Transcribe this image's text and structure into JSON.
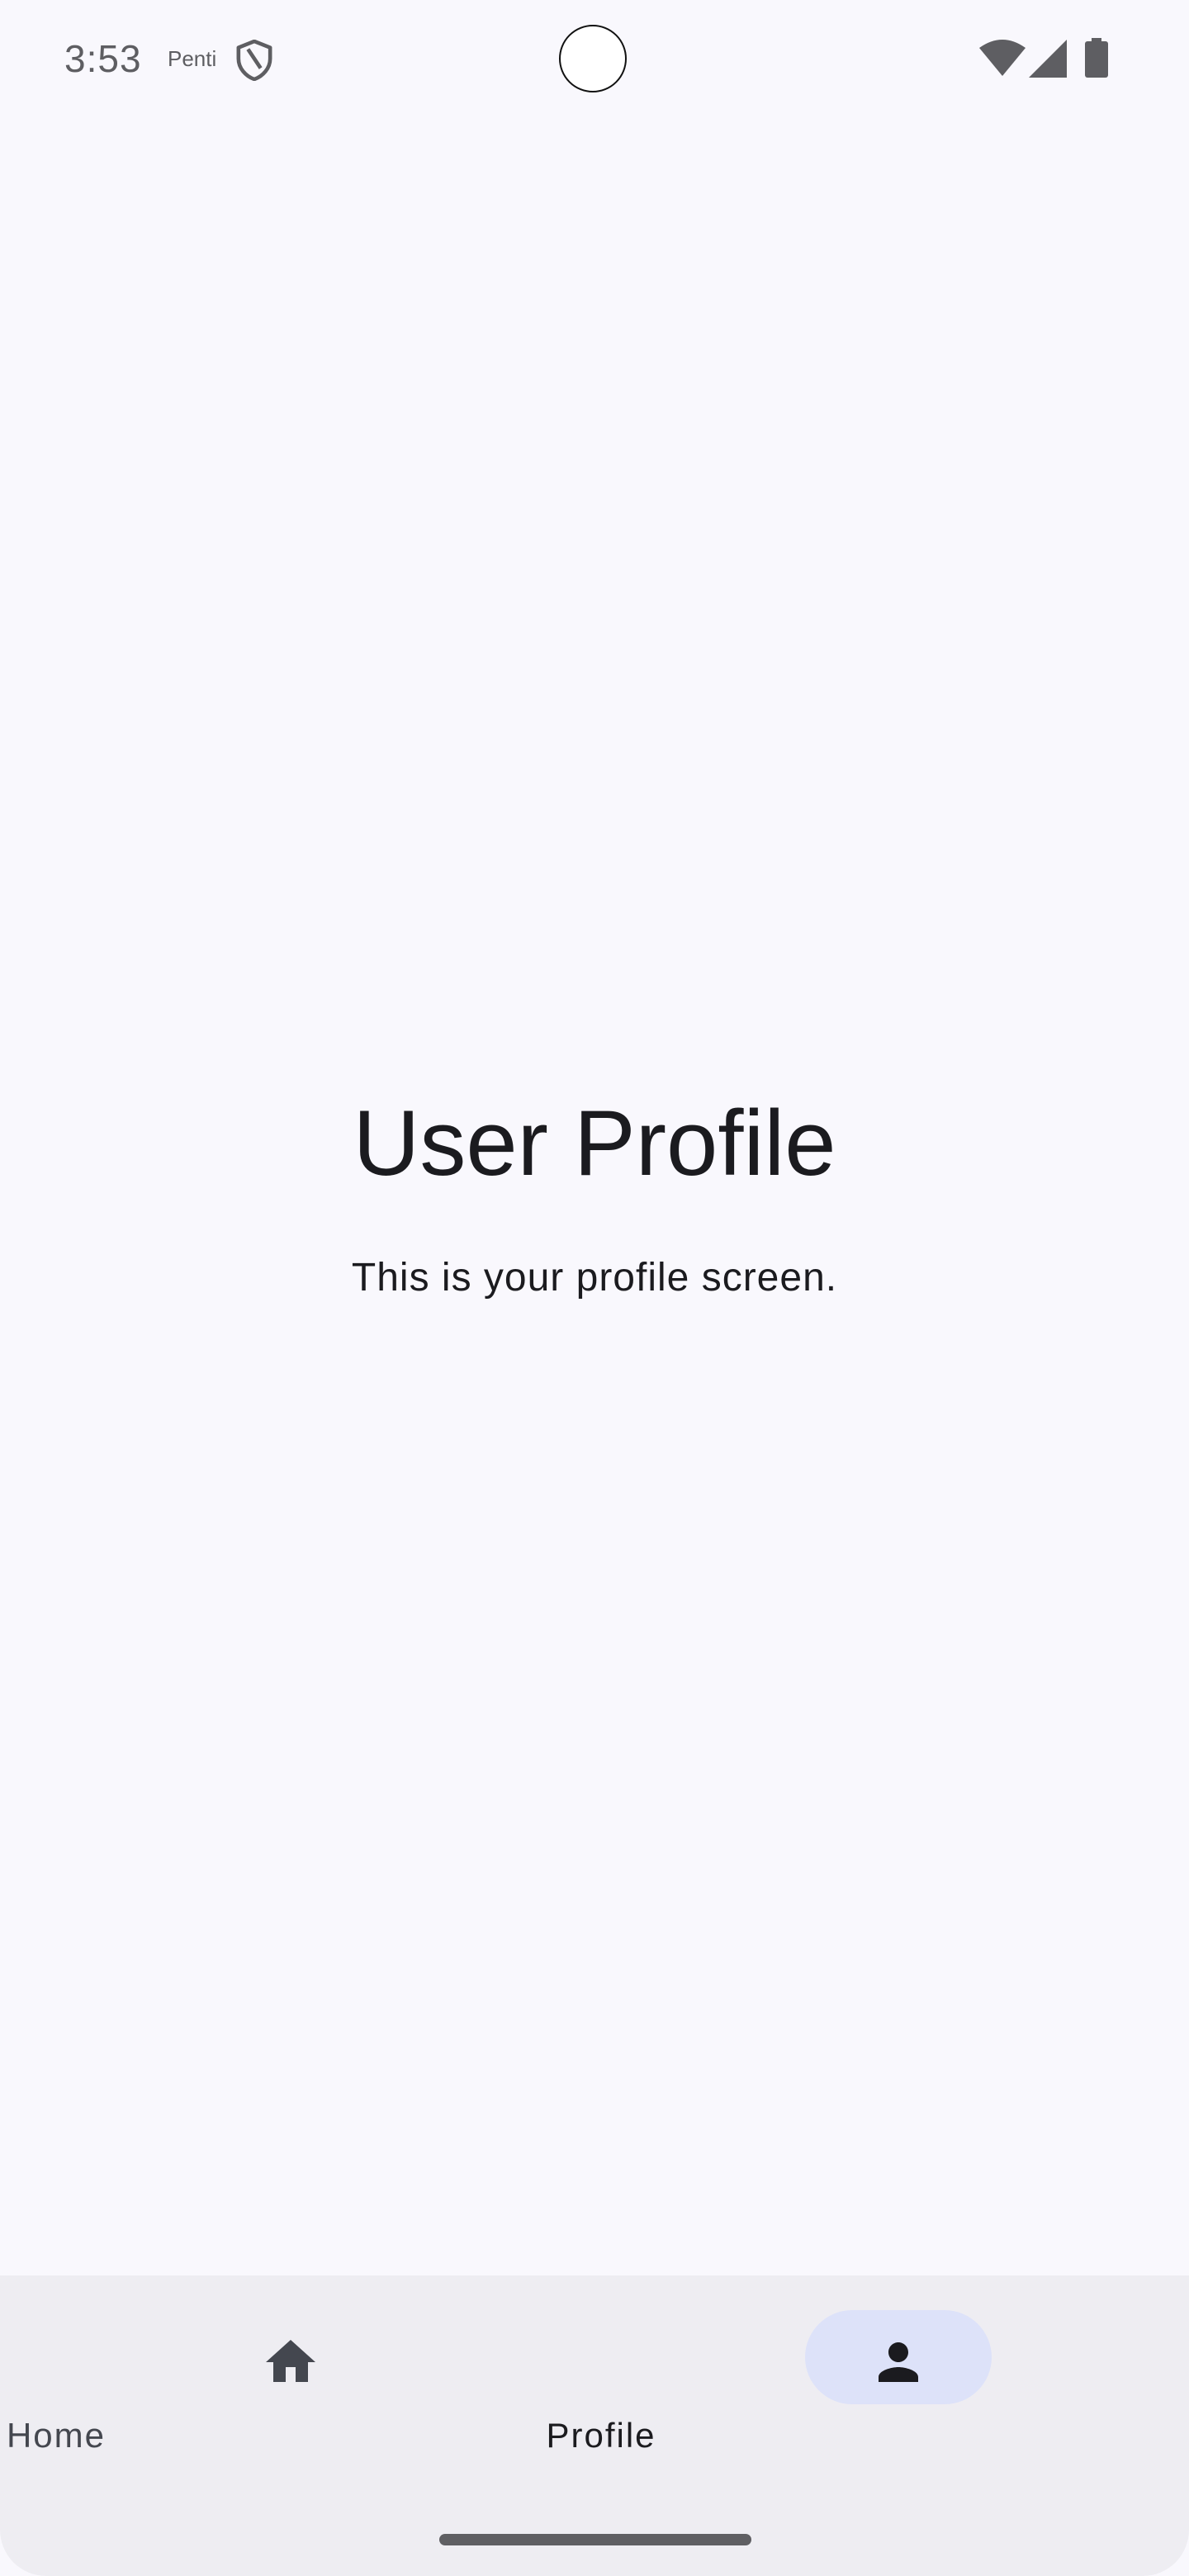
{
  "status_bar": {
    "time": "3:53",
    "carrier": "Penti",
    "icons": [
      "shield-icon",
      "wifi-icon",
      "cell-signal-icon",
      "battery-icon"
    ]
  },
  "content": {
    "title": "User Profile",
    "subtitle": "This is your profile screen."
  },
  "bottom_nav": {
    "items": [
      {
        "label": "Home",
        "icon": "home-icon",
        "selected": false
      },
      {
        "label": "Profile",
        "icon": "person-icon",
        "selected": true
      }
    ]
  },
  "colors": {
    "background": "#f9f8fd",
    "nav_background": "#eeedf2",
    "selected_pill": "#dde2f9",
    "text_primary": "#1b1b1f",
    "icon_muted": "#44474f"
  }
}
